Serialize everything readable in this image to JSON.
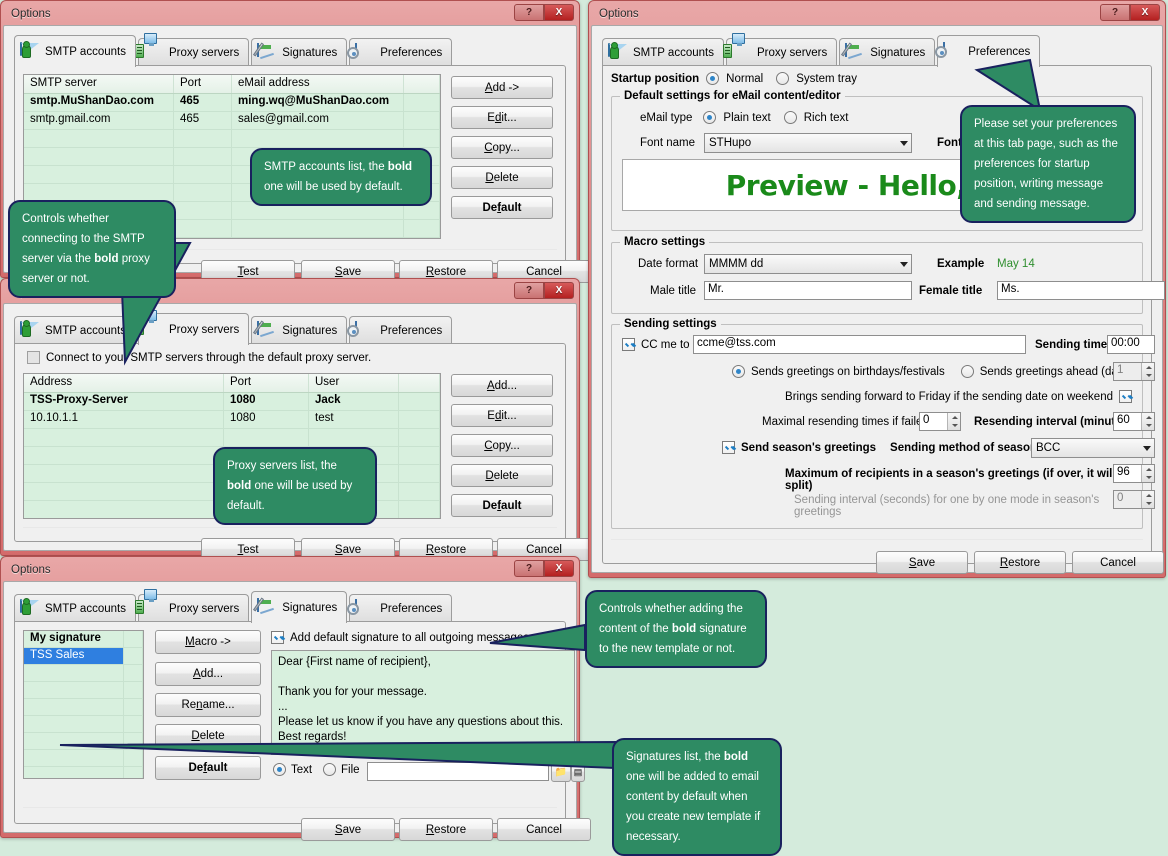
{
  "window_title": "Options",
  "titlebar": {
    "help": "?",
    "close": "X"
  },
  "tabs": [
    {
      "label": "SMTP accounts",
      "icon": "envelope-person-icon"
    },
    {
      "label": "Proxy servers",
      "icon": "monitor-server-icon"
    },
    {
      "label": "Signatures",
      "icon": "pen-signature-icon"
    },
    {
      "label": "Preferences",
      "icon": "gear-preferences-icon"
    }
  ],
  "smtp_window": {
    "active_tab": "SMTP accounts",
    "grid": {
      "columns": [
        "SMTP server",
        "Port",
        "eMail address",
        ""
      ],
      "rows": [
        {
          "bold": true,
          "cells": [
            "smtp.MuShanDao.com",
            "465",
            "ming.wq@MuShanDao.com",
            ""
          ]
        },
        {
          "bold": false,
          "cells": [
            "smtp.gmail.com",
            "465",
            "sales@gmail.com",
            ""
          ]
        }
      ],
      "empty_rows": 7
    },
    "side_buttons": [
      "Add ->",
      "Edit...",
      "Copy...",
      "Delete",
      "Default"
    ],
    "side_buttons_accel": [
      "A",
      "E",
      "C",
      "D",
      "f"
    ],
    "footer_buttons": [
      "Test",
      "Save",
      "Restore",
      "Cancel"
    ]
  },
  "proxy_window": {
    "active_tab": "Proxy servers",
    "checkbox": {
      "label": "Connect to your SMTP servers through the default proxy server.",
      "checked": false
    },
    "grid": {
      "columns": [
        "Address",
        "Port",
        "User",
        ""
      ],
      "rows": [
        {
          "bold": true,
          "cells": [
            "TSS-Proxy-Server",
            "1080",
            "Jack",
            ""
          ]
        },
        {
          "bold": false,
          "cells": [
            "10.10.1.1",
            "1080",
            "test",
            ""
          ]
        }
      ],
      "empty_rows": 6
    },
    "side_buttons": [
      "Add...",
      "Edit...",
      "Copy...",
      "Delete",
      "Default"
    ],
    "footer_buttons": [
      "Test",
      "Save",
      "Restore",
      "Cancel"
    ]
  },
  "signatures_window": {
    "active_tab": "Signatures",
    "list": [
      {
        "label": "My signature",
        "bold": true,
        "selected": false
      },
      {
        "label": "TSS Sales",
        "bold": false,
        "selected": true
      }
    ],
    "list_empty_rows": 8,
    "side_buttons": [
      "Macro ->",
      "Add...",
      "Rename...",
      "Delete",
      "Default"
    ],
    "add_default_checkbox": {
      "label": "Add default signature to all outgoing messages.",
      "checked": true
    },
    "signature_text": "Dear {First name of recipient},\n\nThank you for your message.\n...\nPlease let us know if you have any questions about this.\nBest regards!",
    "source_radios": [
      {
        "label": "Text",
        "selected": true
      },
      {
        "label": "File",
        "selected": false
      }
    ],
    "file_path": "",
    "footer_buttons": [
      "Save",
      "Restore",
      "Cancel"
    ]
  },
  "preferences_window": {
    "active_tab": "Preferences",
    "startup_position": {
      "label": "Startup position",
      "options": [
        {
          "label": "Normal",
          "selected": true
        },
        {
          "label": "System tray",
          "selected": false
        }
      ]
    },
    "email_content": {
      "legend": "Default settings for eMail content/editor",
      "email_type_label": "eMail type",
      "email_type_options": [
        {
          "label": "Plain text",
          "selected": true
        },
        {
          "label": "Rich text",
          "selected": false
        }
      ],
      "font_name_label": "Font name",
      "font_name_value": "STHupo",
      "font_size_label": "Font size",
      "font_size_value": "",
      "preview_text": "Preview - Hello, frie",
      "preview_color": "#1a8a1a"
    },
    "macro": {
      "legend": "Macro settings",
      "date_format_label": "Date format",
      "date_format_value": "MMMM dd",
      "example_label": "Example",
      "example_value": "May 14",
      "male_title_label": "Male title",
      "male_title_value": "Mr.",
      "female_title_label": "Female title",
      "female_title_value": "Ms."
    },
    "sending": {
      "legend": "Sending settings",
      "cc_me_to": {
        "label": "CC me to",
        "checked": true,
        "value": "ccme@tss.com"
      },
      "sending_time_label": "Sending time",
      "sending_time_value": "00:00",
      "greeting_radios": [
        {
          "label": "Sends greetings on birthdays/festivals",
          "selected": true
        },
        {
          "label": "Sends greetings ahead (days)",
          "selected": false
        }
      ],
      "greeting_ahead_days": "1",
      "weekend_forward": {
        "label": "Brings sending forward to Friday if the sending date on weekend",
        "checked": true
      },
      "max_resend_label": "Maximal resending times if failed",
      "max_resend_value": "0",
      "resend_interval_label": "Resending interval (minutes)",
      "resend_interval_value": "60",
      "send_season": {
        "label": "Send season's greetings",
        "checked": true
      },
      "season_method_label": "Sending method of season's greetings",
      "season_method_value": "BCC",
      "max_recipients_label": "Maximum of recipients in a season's greetings (if over, it will be split)",
      "max_recipients_value": "96",
      "one_by_one_label": "Sending interval (seconds) for one by one mode in season's greetings",
      "one_by_one_value": "0"
    },
    "footer_buttons": [
      "Save",
      "Restore",
      "Cancel"
    ]
  },
  "callouts": {
    "smtp_list": {
      "pre": "SMTP accounts list, the ",
      "bold": "bold",
      "post": " one will be used by default."
    },
    "proxy_checkbox": {
      "pre": "Controls whether connecting to the SMTP server via the ",
      "bold": "bold",
      "post": " proxy server or not."
    },
    "proxy_list": {
      "pre": "Proxy servers list, the ",
      "bold": "bold",
      "post": " one will be used by default."
    },
    "preferences_tab": {
      "text": "Please set your preferences at this tab page, such as the preferences for startup position, writing message and sending message."
    },
    "signature_default": {
      "pre": "Controls whether adding the content of the ",
      "bold": "bold",
      "post": " signature to the new template or not."
    },
    "signature_list": {
      "pre": "Signatures list, the ",
      "bold": "bold",
      "post": " one will be added to email content by default when you create new template if necessary."
    }
  },
  "theme": {
    "background": "#d4ebdc",
    "callout_fill": "#2e8b63",
    "callout_border": "#19215e",
    "grid_fill": "#d8f0de",
    "titlebar": "#de8585"
  }
}
